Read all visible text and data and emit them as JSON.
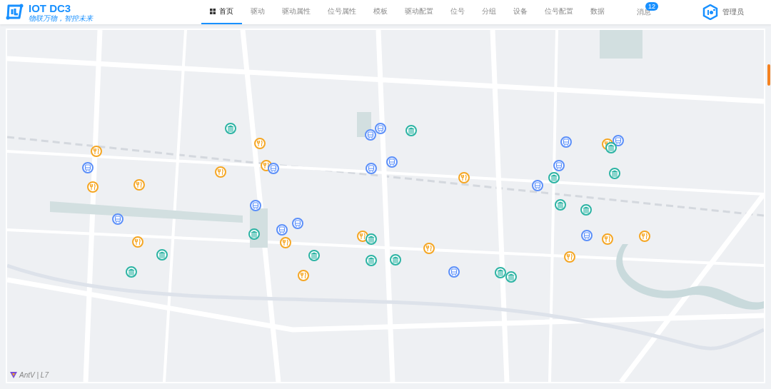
{
  "brand": {
    "title": "IOT DC3",
    "slogan": "物联万物，智控未来"
  },
  "nav": [
    {
      "label": "首页",
      "selected": true,
      "kind": "with-icon"
    },
    {
      "label": "驱动",
      "selected": false,
      "kind": "plain"
    },
    {
      "label": "驱动属性",
      "selected": false,
      "kind": "plain"
    },
    {
      "label": "位号属性",
      "selected": false,
      "kind": "plain"
    },
    {
      "label": "模板",
      "selected": false,
      "kind": "plain"
    },
    {
      "label": "驱动配置",
      "selected": false,
      "kind": "plain"
    },
    {
      "label": "位号",
      "selected": false,
      "kind": "plain"
    },
    {
      "label": "分组",
      "selected": false,
      "kind": "plain"
    },
    {
      "label": "设备",
      "selected": false,
      "kind": "plain"
    },
    {
      "label": "位号配置",
      "selected": false,
      "kind": "plain"
    },
    {
      "label": "数据",
      "selected": false,
      "kind": "plain"
    }
  ],
  "messages": {
    "label": "消息",
    "badge": "12"
  },
  "user": {
    "name": "管理员"
  },
  "map": {
    "attribution": "AntV | L7"
  }
}
